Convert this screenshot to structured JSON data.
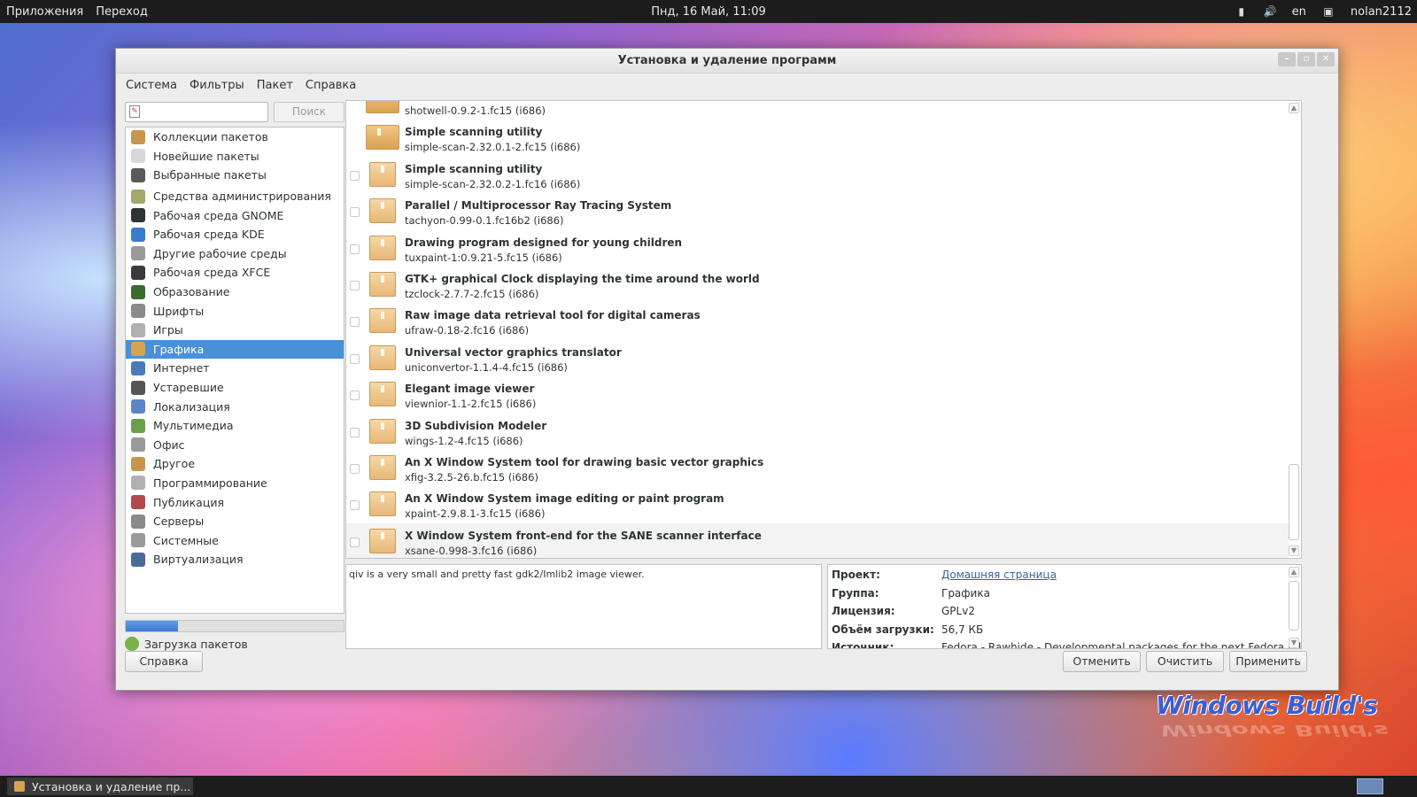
{
  "topbar": {
    "apps": "Приложения",
    "places": "Переход",
    "clock": "Пнд, 16 Май, 11:09",
    "lang": "en",
    "user": "nolan2112"
  },
  "window": {
    "title": "Установка и удаление программ",
    "menu": [
      "Система",
      "Фильтры",
      "Пакет",
      "Справка"
    ]
  },
  "search": {
    "placeholder": "",
    "button": "Поиск"
  },
  "categories": [
    {
      "label": "Коллекции пакетов",
      "icon": "package-collection-icon",
      "color": "#c8954d"
    },
    {
      "label": "Новейшие пакеты",
      "icon": "lightbulb-icon",
      "color": "#d8d8d8"
    },
    {
      "label": "Выбранные пакеты",
      "icon": "magnifier-icon",
      "color": "#5a5a5a"
    },
    {
      "label": "Средства администрирования",
      "icon": "admin-tools-icon",
      "color": "#a5a86a"
    },
    {
      "label": "Рабочая среда GNOME",
      "icon": "gnome-foot-icon",
      "color": "#2e3436"
    },
    {
      "label": "Рабочая среда KDE",
      "icon": "kde-icon",
      "color": "#3b7bcf"
    },
    {
      "label": "Другие рабочие среды",
      "icon": "desktop-icon",
      "color": "#9a9a9a"
    },
    {
      "label": "Рабочая среда XFCE",
      "icon": "xfce-mouse-icon",
      "color": "#3a3a3a"
    },
    {
      "label": "Образование",
      "icon": "education-icon",
      "color": "#3b6b2e"
    },
    {
      "label": "Шрифты",
      "icon": "fonts-icon",
      "color": "#8a8a8a"
    },
    {
      "label": "Игры",
      "icon": "games-icon",
      "color": "#b0b0b0"
    },
    {
      "label": "Графика",
      "icon": "graphics-palette-icon",
      "color": "#d9a251"
    },
    {
      "label": "Интернет",
      "icon": "globe-icon",
      "color": "#4a7ab8"
    },
    {
      "label": "Устаревшие",
      "icon": "floppy-icon",
      "color": "#555555"
    },
    {
      "label": "Локализация",
      "icon": "localization-flag-icon",
      "color": "#5a86c8"
    },
    {
      "label": "Мультимедиа",
      "icon": "multimedia-icon",
      "color": "#6aa04a"
    },
    {
      "label": "Офис",
      "icon": "office-icon",
      "color": "#9a9a9a"
    },
    {
      "label": "Другое",
      "icon": "other-package-icon",
      "color": "#c8954d"
    },
    {
      "label": "Программирование",
      "icon": "programming-icon",
      "color": "#b0b0b0"
    },
    {
      "label": "Публикация",
      "icon": "publishing-icon",
      "color": "#b04a4a"
    },
    {
      "label": "Серверы",
      "icon": "servers-icon",
      "color": "#8a8a8a"
    },
    {
      "label": "Системные",
      "icon": "system-gear-icon",
      "color": "#9a9a9a"
    },
    {
      "label": "Виртуализация",
      "icon": "virtualization-monitor-icon",
      "color": "#4a6a9a"
    }
  ],
  "selected_category": "Графика",
  "progress": {
    "fraction": 0.24,
    "label": "Загрузка пакетов"
  },
  "buttons": {
    "help": "Справка",
    "cancel": "Отменить",
    "clear": "Очистить",
    "apply": "Применить"
  },
  "packages": [
    {
      "summary": "",
      "id": "shotwell-0.9.2-1.fc15 (i686)",
      "installed": true,
      "partial": true
    },
    {
      "summary": "Simple scanning utility",
      "id": "simple-scan-2.32.0.1-2.fc15 (i686)",
      "installed": true
    },
    {
      "summary": "Simple scanning utility",
      "id": "simple-scan-2.32.0.2-1.fc16 (i686)",
      "installed": false
    },
    {
      "summary": "Parallel / Multiprocessor Ray Tracing System",
      "id": "tachyon-0.99-0.1.fc16b2 (i686)",
      "installed": false
    },
    {
      "summary": "Drawing program designed for young children",
      "id": "tuxpaint-1:0.9.21-5.fc15 (i686)",
      "installed": false
    },
    {
      "summary": "GTK+ graphical Clock displaying the time around the world",
      "id": "tzclock-2.7.7-2.fc15 (i686)",
      "installed": false
    },
    {
      "summary": "Raw image data retrieval tool for digital cameras",
      "id": "ufraw-0.18-2.fc16 (i686)",
      "installed": false
    },
    {
      "summary": "Universal vector graphics translator",
      "id": "uniconvertor-1.1.4-4.fc15 (i686)",
      "installed": false
    },
    {
      "summary": "Elegant image viewer",
      "id": "viewnior-1.1-2.fc15 (i686)",
      "installed": false
    },
    {
      "summary": "3D Subdivision Modeler",
      "id": "wings-1.2-4.fc15 (i686)",
      "installed": false
    },
    {
      "summary": "An X Window System tool for drawing basic vector graphics",
      "id": "xfig-3.2.5-26.b.fc15 (i686)",
      "installed": false
    },
    {
      "summary": "An X Window System image editing or paint program",
      "id": "xpaint-2.9.8.1-3.fc15 (i686)",
      "installed": false
    },
    {
      "summary": "X Window System front-end for the SANE scanner interface",
      "id": "xsane-0.998-3.fc16 (i686)",
      "installed": false
    }
  ],
  "description": "qiv is a very small and pretty fast gdk2/Imlib2 image viewer.",
  "details": [
    {
      "key": "Проект:",
      "value": "Домашняя страница",
      "link": true
    },
    {
      "key": "Группа:",
      "value": "Графика",
      "link": false
    },
    {
      "key": "Лицензия:",
      "value": "GPLv2",
      "link": false
    },
    {
      "key": "Объём загрузки:",
      "value": "56,7 КБ",
      "link": false
    },
    {
      "key": "Источник:",
      "value": "Fedora - Rawhide - Developmental packages for the next Fedora release",
      "link": false
    }
  ],
  "taskbar": {
    "item": "Установка и удаление пр..."
  },
  "watermark": "Windows Build's"
}
